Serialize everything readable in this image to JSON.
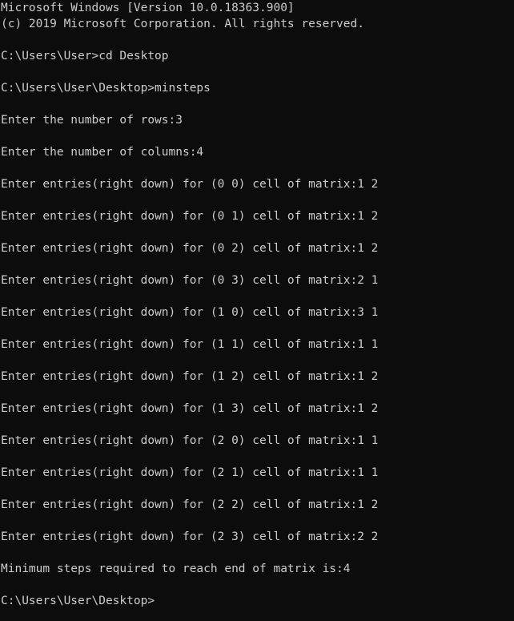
{
  "console": {
    "lines": [
      "Microsoft Windows [Version 10.0.18363.900]",
      "(c) 2019 Microsoft Corporation. All rights reserved.",
      "",
      "C:\\Users\\User>cd Desktop",
      "",
      "C:\\Users\\User\\Desktop>minsteps",
      "",
      "Enter the number of rows:3",
      "",
      "Enter the number of columns:4",
      "",
      "Enter entries(right down) for (0 0) cell of matrix:1 2",
      "",
      "Enter entries(right down) for (0 1) cell of matrix:1 2",
      "",
      "Enter entries(right down) for (0 2) cell of matrix:1 2",
      "",
      "Enter entries(right down) for (0 3) cell of matrix:2 1",
      "",
      "Enter entries(right down) for (1 0) cell of matrix:3 1",
      "",
      "Enter entries(right down) for (1 1) cell of matrix:1 1",
      "",
      "Enter entries(right down) for (1 2) cell of matrix:1 2",
      "",
      "Enter entries(right down) for (1 3) cell of matrix:1 2",
      "",
      "Enter entries(right down) for (2 0) cell of matrix:1 1",
      "",
      "Enter entries(right down) for (2 1) cell of matrix:1 1",
      "",
      "Enter entries(right down) for (2 2) cell of matrix:1 2",
      "",
      "Enter entries(right down) for (2 3) cell of matrix:2 2",
      "",
      "Minimum steps required to reach end of matrix is:4",
      "",
      "C:\\Users\\User\\Desktop>"
    ]
  },
  "colors": {
    "background": "#0c0c0c",
    "foreground": "#cccccc"
  }
}
